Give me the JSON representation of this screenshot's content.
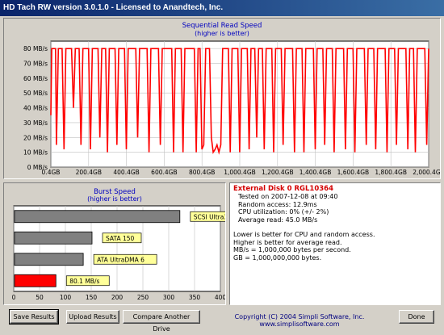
{
  "window": {
    "title": "HD Tach RW version 3.0.1.0 - Licensed to Anandtech, Inc."
  },
  "sequential": {
    "title": "Sequential Read Speed",
    "subtitle": "(higher is better)",
    "y_ticks": [
      "0 MB/s",
      "10 MB/s",
      "20 MB/s",
      "30 MB/s",
      "40 MB/s",
      "50 MB/s",
      "60 MB/s",
      "70 MB/s",
      "80 MB/s"
    ],
    "x_ticks": [
      "0.4GB",
      "200.4GB",
      "400.4GB",
      "600.4GB",
      "800.4GB",
      "1,000.4GB",
      "1,200.4GB",
      "1,400.4GB",
      "1,600.4GB",
      "1,800.4GB",
      "2,000.4GB"
    ],
    "line_color": "#ff0000"
  },
  "burst": {
    "title": "Burst Speed",
    "subtitle": "(higher is better)",
    "x_ticks": [
      "0",
      "50",
      "100",
      "150",
      "200",
      "250",
      "300",
      "350",
      "400"
    ]
  },
  "info": {
    "disk": "External Disk 0 RGL10364",
    "tested": "Tested on 2007-12-08 at 09:40",
    "random_access": "Random access: 12.9ms",
    "cpu": "CPU utilization: 0% (+/- 2%)",
    "average": "Average read: 45.0 MB/s",
    "notes": [
      "Lower is better for CPU and random access.",
      "Higher is better for average read.",
      "MB/s = 1,000,000 bytes per second.",
      "GB = 1,000,000,000 bytes."
    ]
  },
  "buttons": {
    "save": "Save Results",
    "upload": "Upload Results",
    "compare": "Compare Another Drive",
    "done": "Done"
  },
  "copyright": "Copyright (C) 2004 Simpli Software, Inc. www.simplisoftware.com",
  "chart_data": [
    {
      "type": "line",
      "title": "Sequential Read Speed",
      "subtitle": "(higher is better)",
      "xlim": [
        0.4,
        2000.4
      ],
      "ylim": [
        0,
        85
      ],
      "x": [
        0.4,
        5,
        15,
        25,
        30,
        40,
        50,
        60,
        70,
        80,
        90,
        100,
        110,
        120,
        130,
        140,
        150,
        160,
        170,
        180,
        190,
        200,
        210,
        220,
        230,
        240,
        250,
        260,
        270,
        280,
        290,
        300,
        310,
        320,
        330,
        340,
        350,
        360,
        370,
        380,
        390,
        400,
        410,
        420,
        430,
        440,
        450,
        460,
        470,
        480,
        490,
        500,
        510,
        520,
        530,
        540,
        550,
        560,
        570,
        580,
        590,
        600,
        610,
        620,
        630,
        640,
        650,
        660,
        670,
        680,
        690,
        700,
        710,
        720,
        730,
        740,
        750,
        760,
        770,
        780,
        790,
        800,
        810,
        820,
        830,
        840,
        850,
        860,
        870,
        880,
        890,
        900,
        910,
        920,
        930,
        940,
        950,
        960,
        970,
        980,
        990,
        1000,
        1010,
        1020,
        1030,
        1040,
        1050,
        1060,
        1070,
        1080,
        1090,
        1100,
        1110,
        1120,
        1130,
        1140,
        1150,
        1160,
        1170,
        1180,
        1190,
        1200,
        1210,
        1220,
        1230,
        1240,
        1250,
        1260,
        1270,
        1280,
        1290,
        1300,
        1310,
        1320,
        1330,
        1340,
        1350,
        1360,
        1370,
        1380,
        1390,
        1400,
        1410,
        1420,
        1430,
        1440,
        1450,
        1460,
        1470,
        1480,
        1490,
        1500,
        1510,
        1520,
        1530,
        1540,
        1550,
        1560,
        1570,
        1580,
        1590,
        1600,
        1610,
        1620,
        1630,
        1640,
        1650,
        1660,
        1670,
        1680,
        1690,
        1700,
        1710,
        1720,
        1730,
        1740,
        1750,
        1760,
        1770,
        1780,
        1790,
        1800,
        1810,
        1820,
        1830,
        1840,
        1850,
        1860,
        1870,
        1880,
        1890,
        1900,
        1910,
        1920,
        1930,
        1940,
        1950,
        1960,
        1970,
        1980,
        1990,
        2000.4
      ],
      "series": [
        {
          "values": [
            35,
            80,
            80,
            80,
            15,
            80,
            80,
            80,
            12,
            80,
            80,
            80,
            80,
            40,
            80,
            80,
            80,
            15,
            80,
            80,
            80,
            80,
            12,
            80,
            80,
            80,
            80,
            20,
            80,
            80,
            80,
            10,
            80,
            80,
            80,
            80,
            15,
            80,
            80,
            80,
            80,
            12,
            80,
            80,
            80,
            80,
            80,
            20,
            80,
            80,
            80,
            80,
            80,
            10,
            80,
            80,
            80,
            80,
            80,
            15,
            80,
            80,
            80,
            80,
            80,
            80,
            10,
            80,
            80,
            80,
            80,
            10,
            80,
            80,
            80,
            80,
            80,
            80,
            10,
            80,
            80,
            12,
            15,
            80,
            80,
            80,
            20,
            10,
            12,
            15,
            10,
            15,
            80,
            80,
            80,
            80,
            10,
            80,
            80,
            80,
            80,
            10,
            80,
            80,
            80,
            80,
            12,
            80,
            80,
            80,
            20,
            80,
            80,
            80,
            12,
            80,
            80,
            80,
            80,
            10,
            80,
            80,
            80,
            80,
            15,
            80,
            80,
            80,
            80,
            80,
            10,
            80,
            80,
            80,
            80,
            10,
            80,
            80,
            80,
            80,
            80,
            12,
            80,
            80,
            80,
            80,
            15,
            80,
            80,
            80,
            80,
            10,
            80,
            80,
            80,
            80,
            80,
            12,
            80,
            80,
            80,
            80,
            10,
            80,
            80,
            80,
            80,
            80,
            15,
            80,
            80,
            80,
            80,
            12,
            80,
            80,
            80,
            80,
            80,
            10,
            80,
            80,
            80,
            80,
            15,
            80,
            80,
            80,
            80,
            80,
            12,
            80,
            80,
            80,
            10,
            80,
            80,
            80,
            80,
            80,
            15,
            80,
            80,
            80,
            20,
            80,
            80,
            80,
            12,
            5
          ]
        }
      ]
    },
    {
      "type": "bar",
      "title": "Burst Speed",
      "subtitle": "(higher is better)",
      "xlim": [
        0,
        400
      ],
      "categories": [
        "SCSI Ultra320",
        "SATA 150",
        "ATA UltraDMA 6",
        "80.1 MB/s"
      ],
      "values": [
        320,
        150,
        133,
        80.1
      ],
      "colors": [
        "#808080",
        "#808080",
        "#808080",
        "#ff0000"
      ]
    }
  ]
}
